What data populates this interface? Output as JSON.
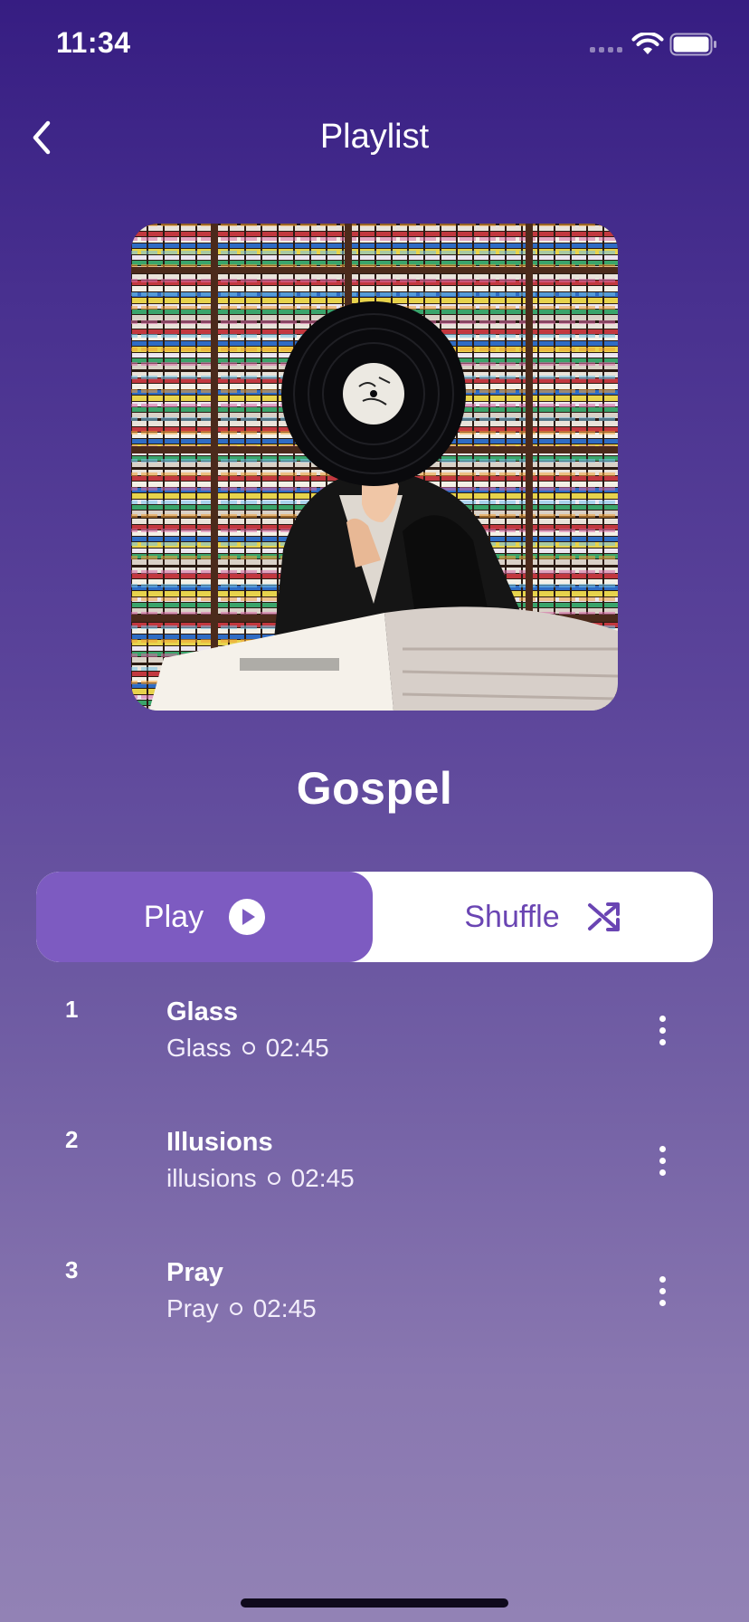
{
  "status_bar": {
    "time": "11:34",
    "icons": [
      "signal-icon",
      "wifi-icon",
      "battery-icon"
    ]
  },
  "header": {
    "title": "Playlist",
    "back_icon": "chevron-left-icon"
  },
  "playlist": {
    "name": "Gospel",
    "cover_icon": "album-cover-image"
  },
  "controls": {
    "play_label": "Play",
    "play_icon": "play-circle-icon",
    "shuffle_label": "Shuffle",
    "shuffle_icon": "shuffle-icon"
  },
  "tracks": [
    {
      "number": "1",
      "title": "Glass",
      "artist": "Glass",
      "duration": "02:45"
    },
    {
      "number": "2",
      "title": "Illusions",
      "artist": "illusions",
      "duration": "02:45"
    },
    {
      "number": "3",
      "title": "Pray",
      "artist": "Pray",
      "duration": "02:45"
    }
  ],
  "colors": {
    "background_top": "#361d82",
    "background_bottom": "#9282b5",
    "play_button": "#7d5bc1",
    "shuffle_text": "#6a45b3",
    "segment_background": "#ffffff"
  }
}
